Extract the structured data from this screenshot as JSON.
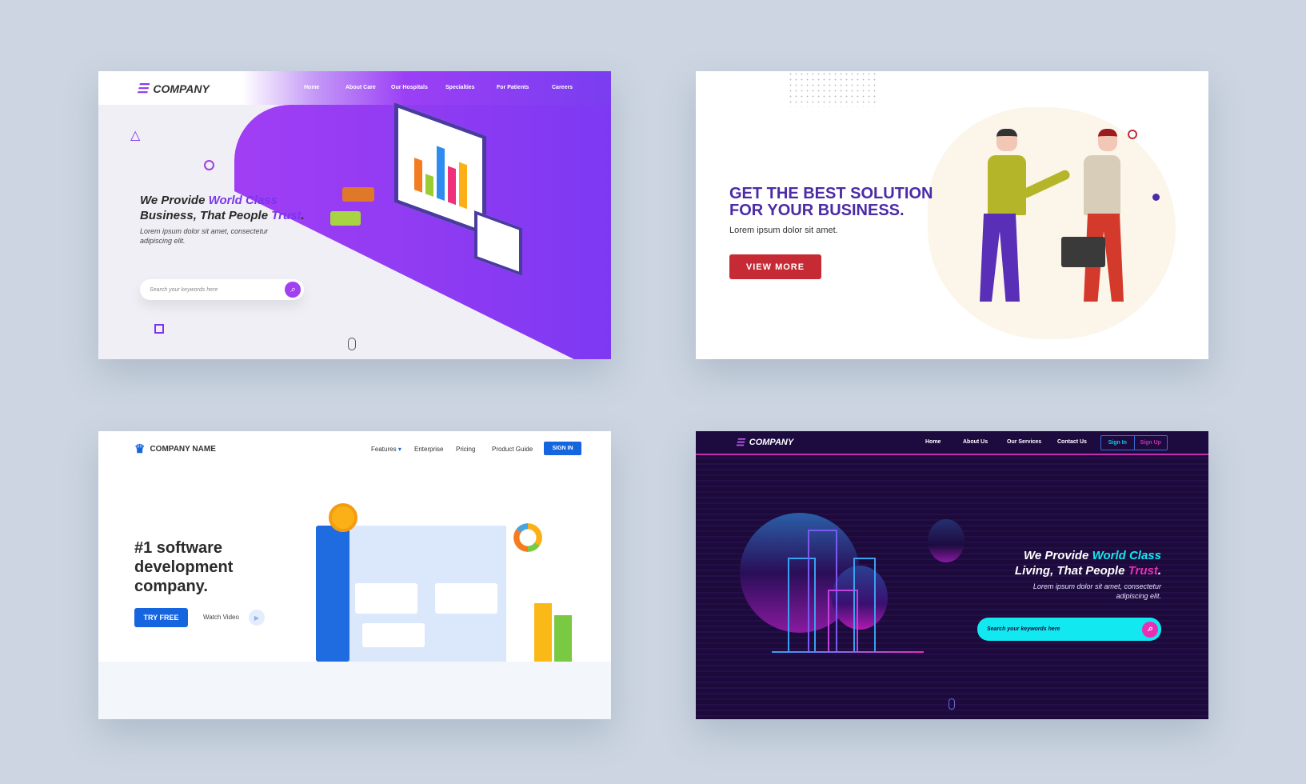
{
  "panel1": {
    "logo": "COMPANY",
    "nav": [
      "Home",
      "About Care",
      "Our Hospitals",
      "Specialties",
      "For Patients",
      "Careers"
    ],
    "headline_a": "We Provide ",
    "headline_b": "World Class",
    "headline_c": "Business, That People ",
    "headline_d": "Trust",
    "headline_e": ".",
    "sub": "Lorem ipsum dolor sit amet, consectetur adipiscing elit.",
    "search_placeholder": "Search your keywords here",
    "accent": "#8a3cf3"
  },
  "panel2": {
    "headline": "GET THE BEST SOLUTION FOR YOUR BUSINESS.",
    "sub": "Lorem ipsum dolor sit amet.",
    "button": "VIEW MORE",
    "accent": "#4b2ba6",
    "button_color": "#c62a35"
  },
  "panel3": {
    "logo": "COMPANY NAME",
    "nav": [
      "Features",
      "Enterprise",
      "Pricing",
      "Product Guide"
    ],
    "sign_in": "SIGN IN",
    "headline": "#1 software development company.",
    "try_free": "TRY FREE",
    "watch_video": "Watch Video",
    "accent": "#1565e0"
  },
  "panel4": {
    "logo": "COMPANY",
    "nav": [
      "Home",
      "About Us",
      "Our Services",
      "Contact Us"
    ],
    "sign_in": "Sign In",
    "sign_up": "Sign Up",
    "headline_a": "We Provide ",
    "headline_b": "World Class",
    "headline_c": "Living, That People ",
    "headline_d": "Trust",
    "headline_e": ".",
    "sub": "Lorem ipsum dolor sit amet, consectetur adipiscing elit.",
    "search_placeholder": "Search your keywords here",
    "accent_cyan": "#12e8f0",
    "accent_pink": "#e830b5"
  }
}
